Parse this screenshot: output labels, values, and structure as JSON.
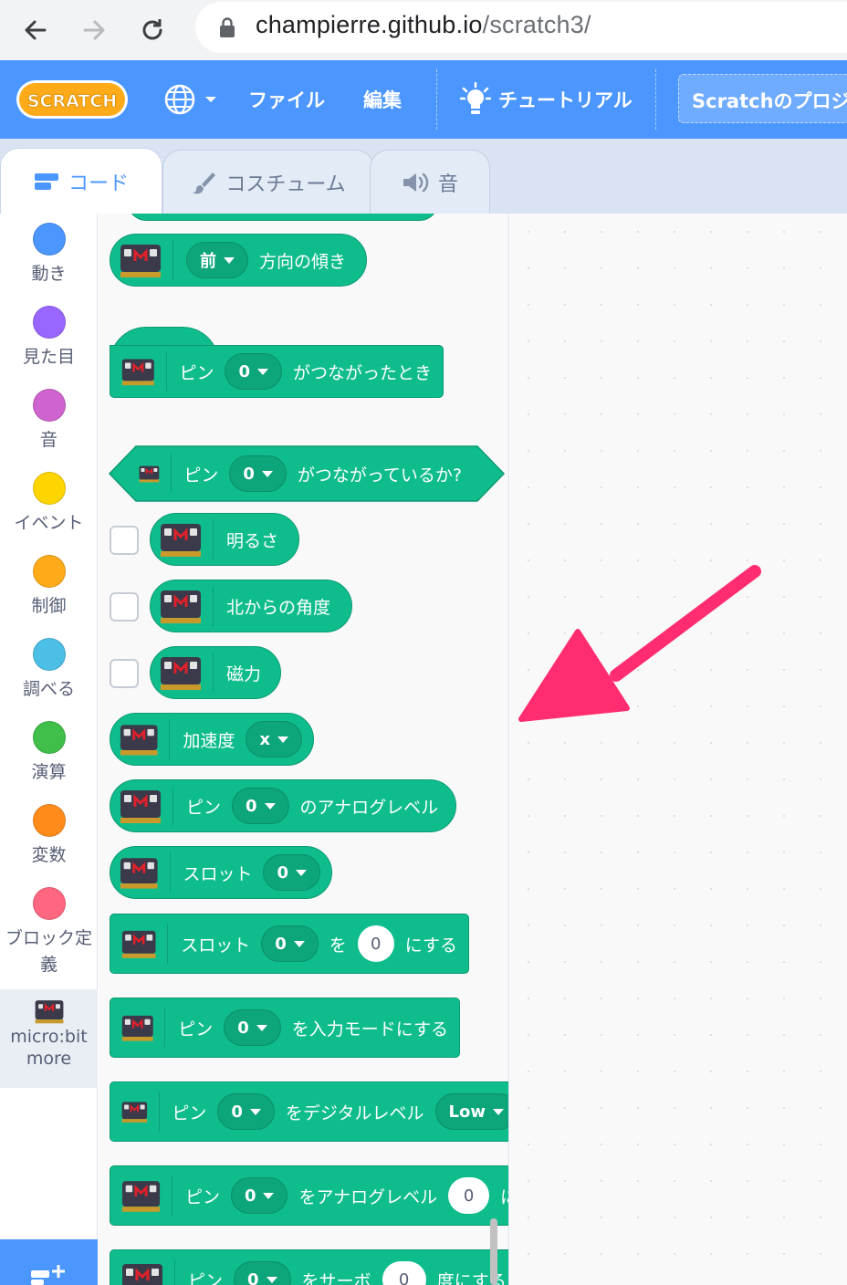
{
  "browser": {
    "url_host": "champierre.github.io",
    "url_path": "/scratch3/"
  },
  "menu": {
    "logo_text": "SCRATCH",
    "file": "ファイル",
    "edit": "編集",
    "tutorial": "チュートリアル",
    "project_title": "Scratchのプロジ"
  },
  "tabs": {
    "code": "コード",
    "costume": "コスチューム",
    "sound": "音"
  },
  "categories": [
    {
      "label": "動き",
      "color": "#4c97ff"
    },
    {
      "label": "見た目",
      "color": "#9966ff"
    },
    {
      "label": "音",
      "color": "#cf63cf"
    },
    {
      "label": "イベント",
      "color": "#ffd500"
    },
    {
      "label": "制御",
      "color": "#ffab19"
    },
    {
      "label": "調べる",
      "color": "#4cbfe6"
    },
    {
      "label": "演算",
      "color": "#40bf4a"
    },
    {
      "label": "変数",
      "color": "#ff8c1a"
    },
    {
      "label": "ブロック定義",
      "color": "#ff6680"
    },
    {
      "label_line1": "micro:bit",
      "label_line2": "more"
    }
  ],
  "blocks": {
    "tilt": {
      "dropdown": "前",
      "text": "方向の傾き"
    },
    "pin_connected_hat": {
      "pin_label": "ピン",
      "dropdown": "0",
      "text": "がつながったとき"
    },
    "pin_connected_bool": {
      "pin_label": "ピン",
      "dropdown": "0",
      "text": "がつながっているか?"
    },
    "brightness": {
      "text": "明るさ"
    },
    "compass": {
      "text": "北からの角度"
    },
    "magnetic": {
      "text": "磁力"
    },
    "acceleration": {
      "text": "加速度",
      "dropdown": "x"
    },
    "analog_level": {
      "pin_label": "ピン",
      "dropdown": "0",
      "text": "のアナログレベル"
    },
    "slot": {
      "text": "スロット",
      "dropdown": "0"
    },
    "set_slot": {
      "text": "スロット",
      "dropdown": "0",
      "text2": "を",
      "input": "0",
      "text3": "にする"
    },
    "input_mode": {
      "pin_label": "ピン",
      "dropdown": "0",
      "text": "を入力モードにする"
    },
    "digital_level": {
      "pin_label": "ピン",
      "dropdown": "0",
      "text": "をデジタルレベル",
      "dropdown2": "Low"
    },
    "set_analog": {
      "pin_label": "ピン",
      "dropdown": "0",
      "text": "をアナログレベル",
      "input": "0",
      "text2": "に"
    },
    "servo": {
      "pin_label": "ピン",
      "dropdown": "0",
      "text": "をサーボ",
      "input": "0",
      "text2": "度にする"
    }
  },
  "colors": {
    "menu_blue": "#4c97ff",
    "extension_green": "#0fbd8c",
    "annotation_pink": "#ff2d6f"
  }
}
